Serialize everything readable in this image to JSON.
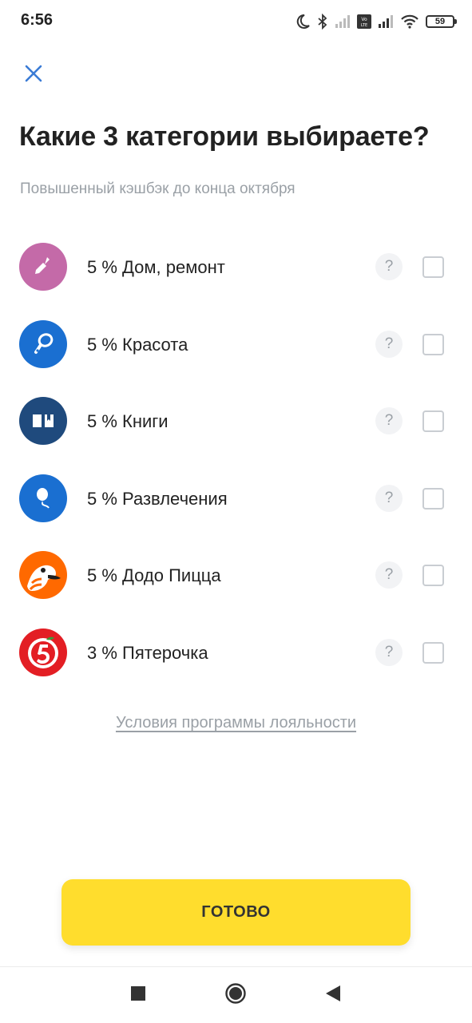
{
  "status_bar": {
    "time": "6:56",
    "battery": "59",
    "icons": [
      "moon-icon",
      "bluetooth-icon",
      "signal-icon",
      "volte-icon",
      "signal-icon",
      "wifi-icon",
      "battery-icon"
    ]
  },
  "header": {
    "close_icon": "close-icon",
    "title": "Какие 3 категории выбираете?",
    "subtitle": "Повышенный кэшбэк до конца октября"
  },
  "categories": [
    {
      "label": "5 % Дом, ремонт",
      "icon": "trowel-icon",
      "color": "#c46aa8",
      "checked": false,
      "help": "?"
    },
    {
      "label": "5 % Красота",
      "icon": "mirror-icon",
      "color": "#1a6fd1",
      "checked": false,
      "help": "?"
    },
    {
      "label": "5 % Книги",
      "icon": "book-icon",
      "color": "#1f4a7d",
      "checked": false,
      "help": "?"
    },
    {
      "label": "5 % Развлечения",
      "icon": "balloon-icon",
      "color": "#1a6fd1",
      "checked": false,
      "help": "?"
    },
    {
      "label": "5 % Додо Пицца",
      "icon": "dodo-icon",
      "color": "#ff6900",
      "checked": false,
      "help": "?"
    },
    {
      "label": "3 % Пятерочка",
      "icon": "pyaterochka-icon",
      "color": "#e31e24",
      "checked": false,
      "help": "?"
    }
  ],
  "loyalty_link": "Условия программы лояльности",
  "done_button": "ГОТОВО",
  "colors": {
    "accent_yellow": "#ffdd2d",
    "close_blue": "#3a7bd5",
    "muted_text": "#9aa0a6"
  },
  "nav": {
    "recents_icon": "square-icon",
    "home_icon": "circle-icon",
    "back_icon": "triangle-back-icon"
  }
}
